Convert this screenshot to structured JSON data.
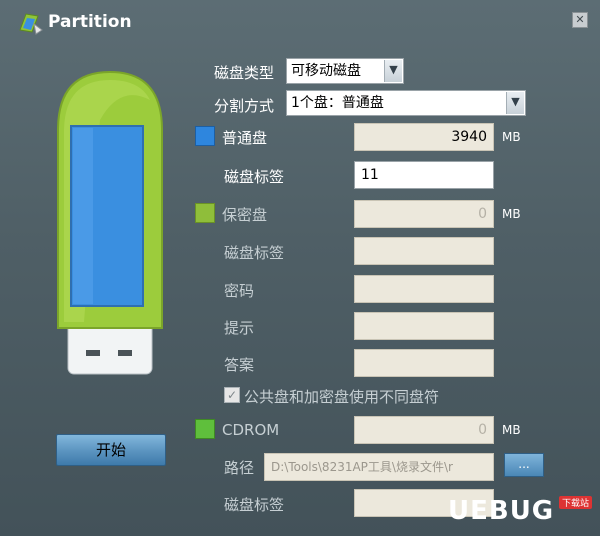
{
  "window": {
    "title": "Partition",
    "close_glyph": "✕"
  },
  "disk_type": {
    "label": "磁盘类型",
    "value": "可移动磁盘"
  },
  "partition_mode": {
    "label": "分割方式",
    "value": "1个盘：普通盘"
  },
  "normal_disk": {
    "label": "普通盘",
    "size": "3940",
    "unit": "MB",
    "swatch_color": "#2e86de",
    "tag_label": "磁盘标签",
    "tag_value": "11"
  },
  "secure_disk": {
    "label": "保密盘",
    "size": "0",
    "unit": "MB",
    "swatch_color": "#8fbe3a",
    "tag_label": "磁盘标签",
    "tag_value": "",
    "password_label": "密码",
    "password_value": "",
    "hint_label": "提示",
    "hint_value": "",
    "answer_label": "答案",
    "answer_value": "",
    "diff_letter_label": "公共盘和加密盘使用不同盘符",
    "diff_letter_checked": true
  },
  "cdrom": {
    "label": "CDROM",
    "size": "0",
    "unit": "MB",
    "swatch_color": "#5fbf3c",
    "path_label": "路径",
    "path_value": "D:\\Tools\\8231AP工具\\烧录文件\\r",
    "browse_label": "...",
    "tag_label": "磁盘标签",
    "tag_value": ""
  },
  "start_button": {
    "label": "开始"
  },
  "watermark": {
    "text": "UEBUG",
    "small": "下载站"
  },
  "colors": {
    "accent": "#5a93bf",
    "usb_body": "#9ccc3c",
    "usb_screen": "#3a8fe0"
  }
}
